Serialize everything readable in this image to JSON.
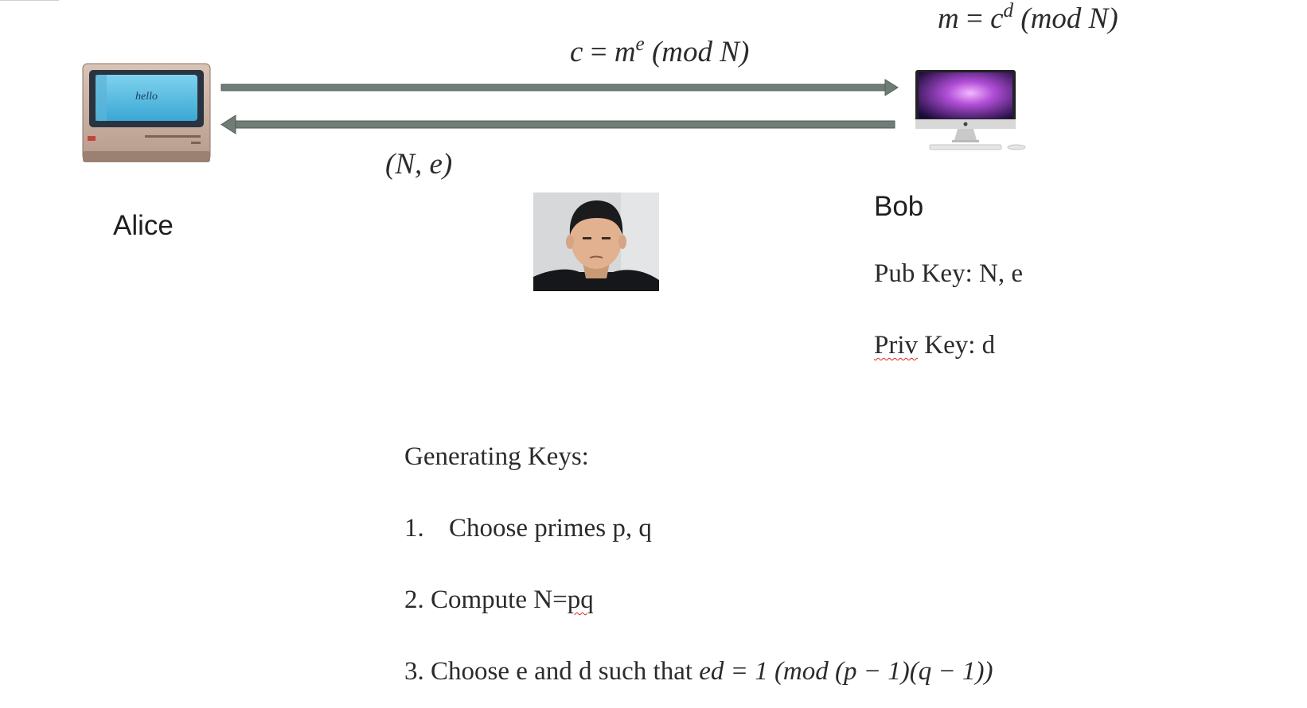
{
  "equations": {
    "bob_decrypt": {
      "lhs": "m",
      "eq": " = ",
      "base": "c",
      "exp": "d",
      "mod": " (mod N)"
    },
    "alice_encrypt": {
      "lhs": "c",
      "eq": " = ",
      "base": "m",
      "exp": "e",
      "mod": " (mod N)"
    },
    "public_key": "(N, e)"
  },
  "alice": {
    "label": "Alice",
    "screen_text": "hello"
  },
  "bob": {
    "label": "Bob",
    "pub_key": "Pub Key: N, e",
    "priv_key_word": "Priv",
    "priv_key_rest": " Key: d"
  },
  "generating": {
    "title": "Generating Keys:",
    "step1_num": "1.",
    "step1_text": "Choose primes p, q",
    "step2_prefix": "2. Compute N=",
    "step2_pq": "pq",
    "step3_prefix": "3. Choose e and d such that ",
    "step3_math": "ed = 1 (mod (p − 1)(q − 1))"
  },
  "colors": {
    "arrow": "#6f7d76",
    "arrow_stroke": "#515d57",
    "text": "#2b2b2b"
  }
}
